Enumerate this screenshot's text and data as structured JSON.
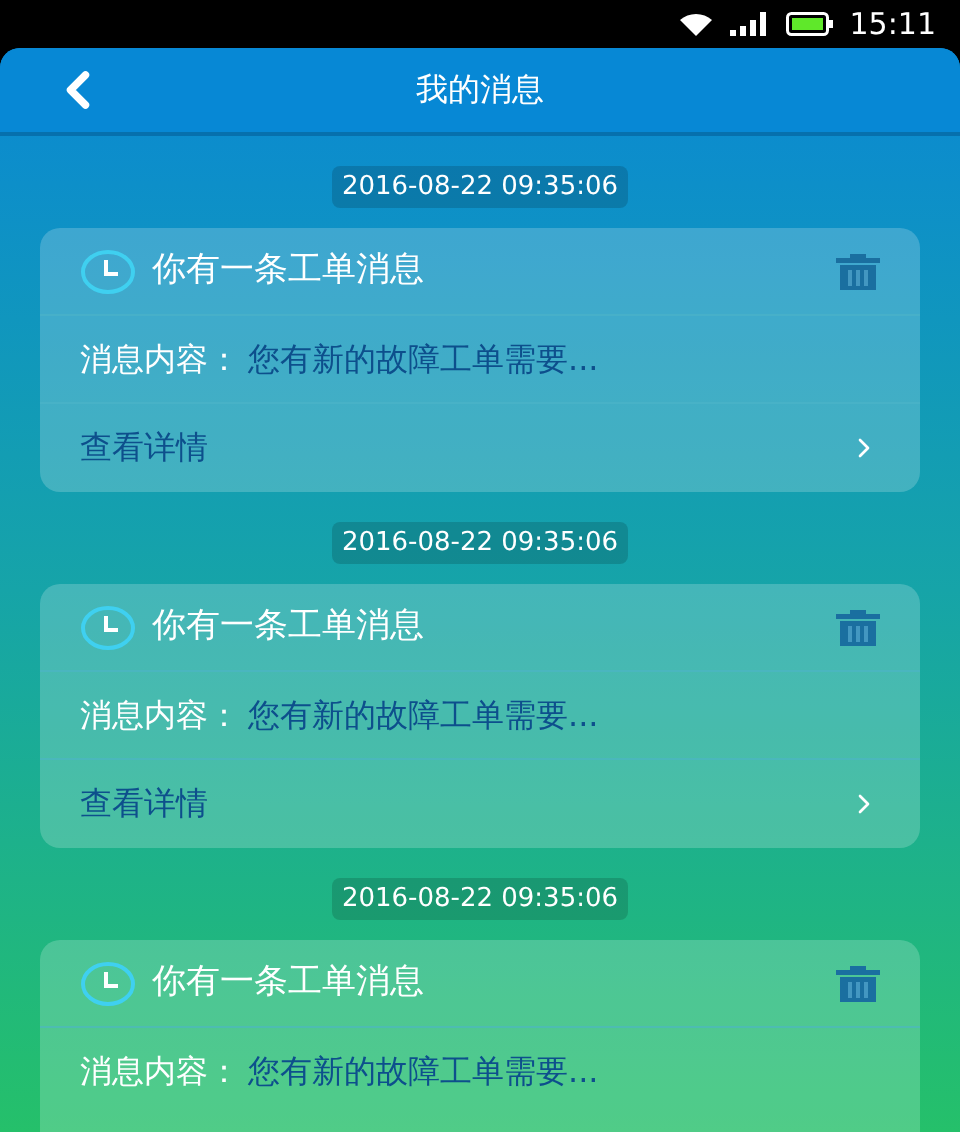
{
  "status_bar": {
    "time": "15:11"
  },
  "header": {
    "title": "我的消息"
  },
  "messages": [
    {
      "time": "2016-08-22 09:35:06",
      "title": "你有一条工单消息",
      "content_label": "消息内容：",
      "content": "您有新的故障工单需要...",
      "details": "查看详情"
    },
    {
      "time": "2016-08-22 09:35:06",
      "title": "你有一条工单消息",
      "content_label": "消息内容：",
      "content": "您有新的故障工单需要...",
      "details": "查看详情"
    },
    {
      "time": "2016-08-22 09:35:06",
      "title": "你有一条工单消息",
      "content_label": "消息内容：",
      "content": "您有新的故障工单需要..."
    }
  ]
}
